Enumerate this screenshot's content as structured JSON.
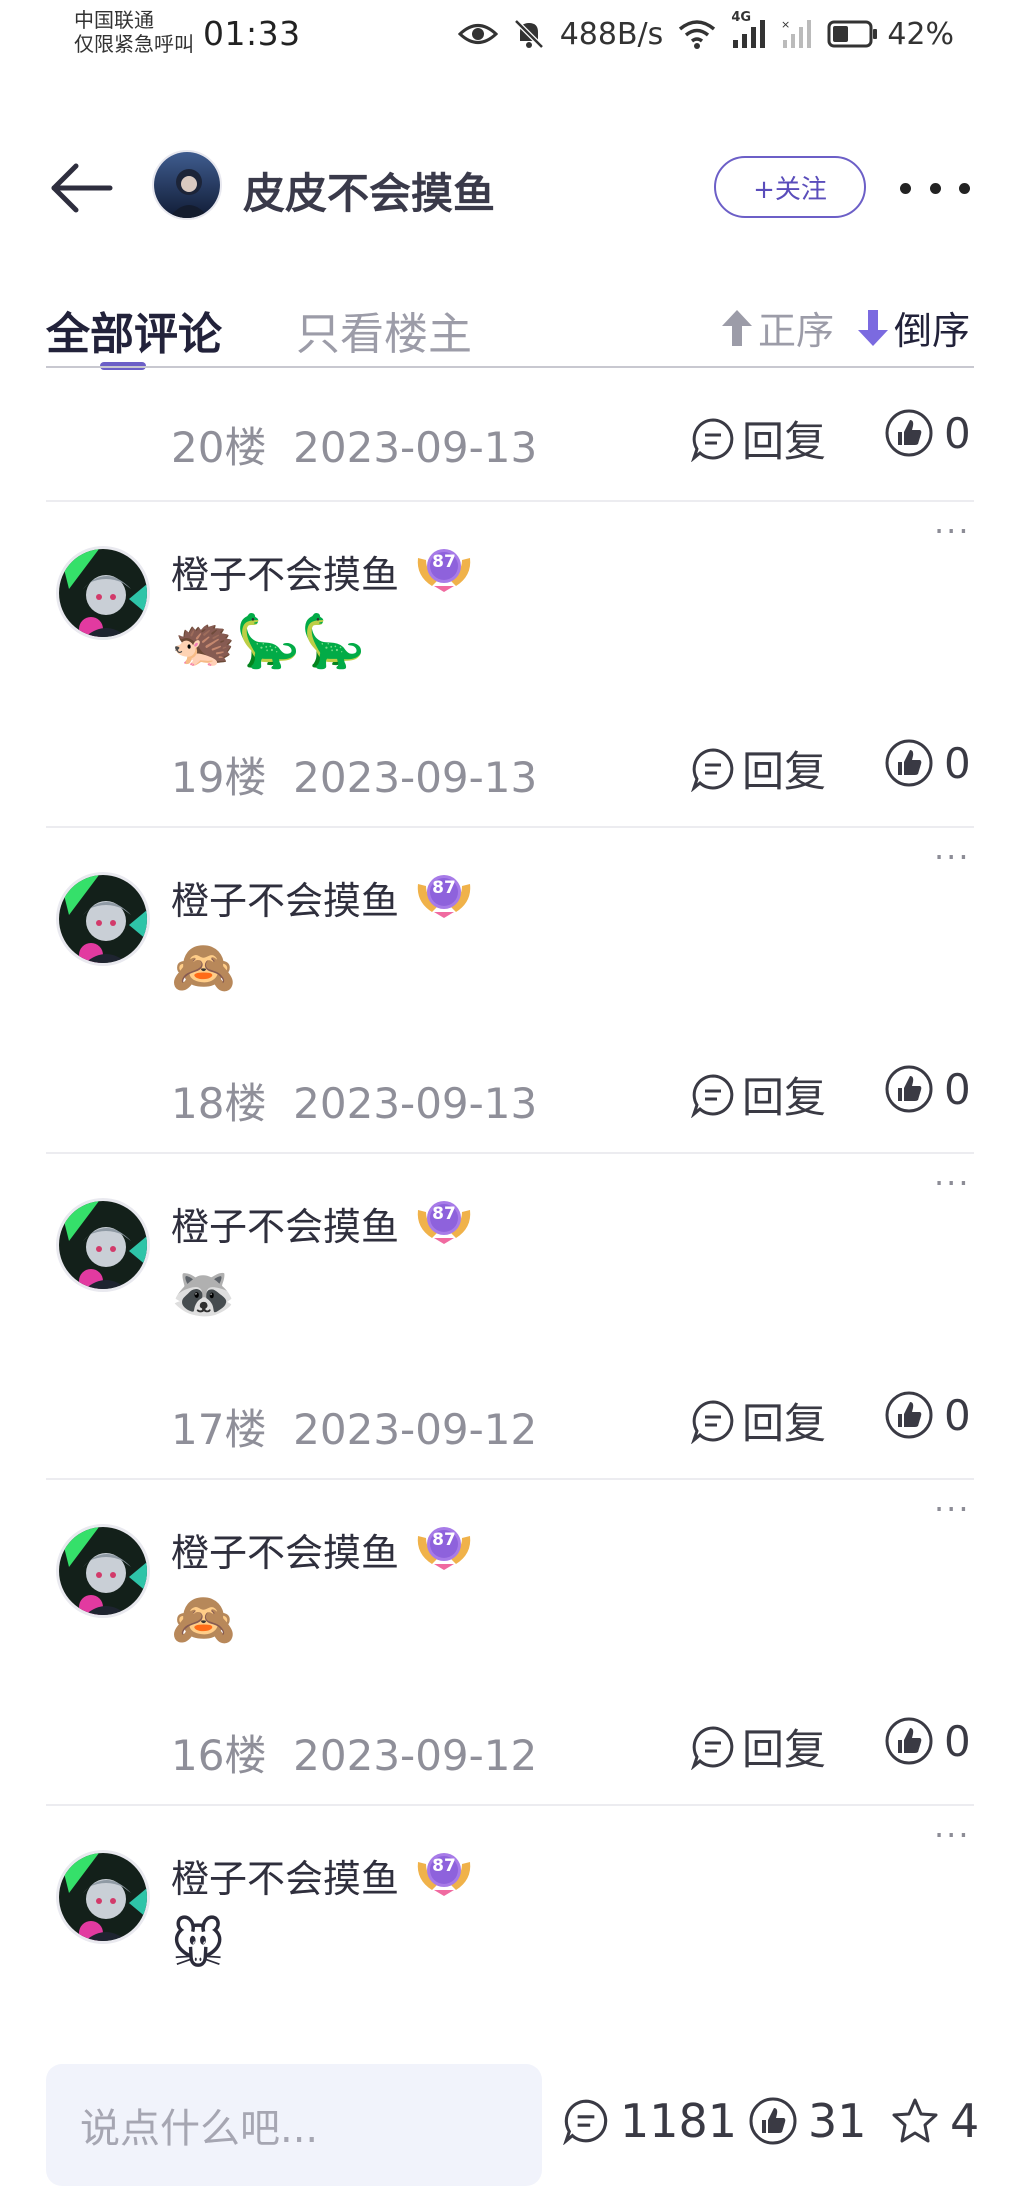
{
  "status_bar": {
    "carrier_line1": "中国联通",
    "carrier_line2": "仅限紧急呼叫",
    "time": "01:33",
    "net_speed": "488B/s",
    "network_type": "4G",
    "battery": "42%",
    "icons": [
      "eye-icon",
      "bell-off-icon",
      "wifi-icon",
      "signal-icon",
      "signal-off-icon",
      "battery-icon"
    ]
  },
  "header": {
    "back_icon": "back-arrow-icon",
    "author_name": "皮皮不会摸鱼",
    "follow_label": "+关注",
    "more_icon": "more-icon"
  },
  "tabs": {
    "items": [
      {
        "label": "全部评论",
        "active": true
      },
      {
        "label": "只看楼主",
        "active": false
      }
    ],
    "sort_asc": "正序",
    "sort_desc": "倒序",
    "accent_color": "#6c5fc7"
  },
  "first_meta": {
    "floor": "20楼",
    "date": "2023-09-13",
    "reply_label": "回复",
    "likes": "0"
  },
  "comments": [
    {
      "user": "橙子不会摸鱼",
      "level": "87",
      "content": "🦔🦕🦕",
      "floor": "19楼",
      "date": "2023-09-13",
      "reply_label": "回复",
      "likes": "0"
    },
    {
      "user": "橙子不会摸鱼",
      "level": "87",
      "content": "🙈",
      "floor": "18楼",
      "date": "2023-09-13",
      "reply_label": "回复",
      "likes": "0"
    },
    {
      "user": "橙子不会摸鱼",
      "level": "87",
      "content": "🦝",
      "floor": "17楼",
      "date": "2023-09-12",
      "reply_label": "回复",
      "likes": "0"
    },
    {
      "user": "橙子不会摸鱼",
      "level": "87",
      "content": "🙈",
      "floor": "16楼",
      "date": "2023-09-12",
      "reply_label": "回复",
      "likes": "0"
    },
    {
      "user": "橙子不会摸鱼",
      "level": "87",
      "content": "🐭",
      "floor": "",
      "date": "",
      "reply_label": "",
      "likes": ""
    }
  ],
  "bottom_bar": {
    "placeholder": "说点什么吧...",
    "comment_count": "1181",
    "like_count": "31",
    "star_count": "4"
  }
}
